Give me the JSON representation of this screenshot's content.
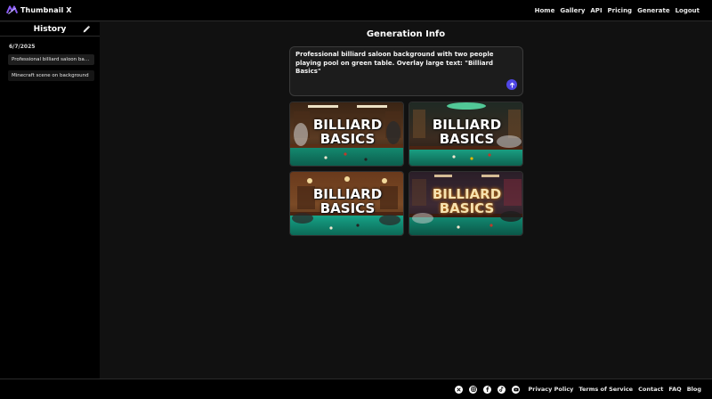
{
  "brand": {
    "name": "Thumbnail X",
    "logo_icon": "logo-icon",
    "accent": "#8b5cf6"
  },
  "nav": [
    {
      "name": "nav-home",
      "label": "Home"
    },
    {
      "name": "nav-gallery",
      "label": "Gallery"
    },
    {
      "name": "nav-api",
      "label": "API"
    },
    {
      "name": "nav-pricing",
      "label": "Pricing"
    },
    {
      "name": "nav-generate",
      "label": "Generate"
    },
    {
      "name": "nav-logout",
      "label": "Logout"
    }
  ],
  "sidebar": {
    "title": "History",
    "edit_icon": "edit-icon",
    "date": "6/7/2025",
    "items": [
      {
        "label": "Professional billiard saloon background with two people playing pool on green table"
      },
      {
        "label": "Minecraft scene on background"
      }
    ]
  },
  "main": {
    "title": "Generation Info",
    "prompt": "Professional billiard saloon background with two people playing pool on green table. Overlay large text: \"Billiard Basics\"",
    "send_icon": "arrow-up-icon",
    "send_color": "#4f46e5",
    "thumbnails": [
      {
        "name": "thumbnail-1",
        "line1": "BILLIARD",
        "line2": "BASICS",
        "style": "white"
      },
      {
        "name": "thumbnail-2",
        "line1": "BILLIARD",
        "line2": "BASICS",
        "style": "white"
      },
      {
        "name": "thumbnail-3",
        "line1": "BILLIARD",
        "line2": "BASICS",
        "style": "white"
      },
      {
        "name": "thumbnail-4",
        "line1": "BILLIARD",
        "line2": "BASICS",
        "style": "gold"
      }
    ]
  },
  "footer": {
    "social": [
      "x-icon",
      "instagram-icon",
      "facebook-icon",
      "tiktok-icon",
      "youtube-icon"
    ],
    "links": [
      "Privacy Policy",
      "Terms of Service",
      "Contact",
      "FAQ",
      "Blog"
    ]
  }
}
